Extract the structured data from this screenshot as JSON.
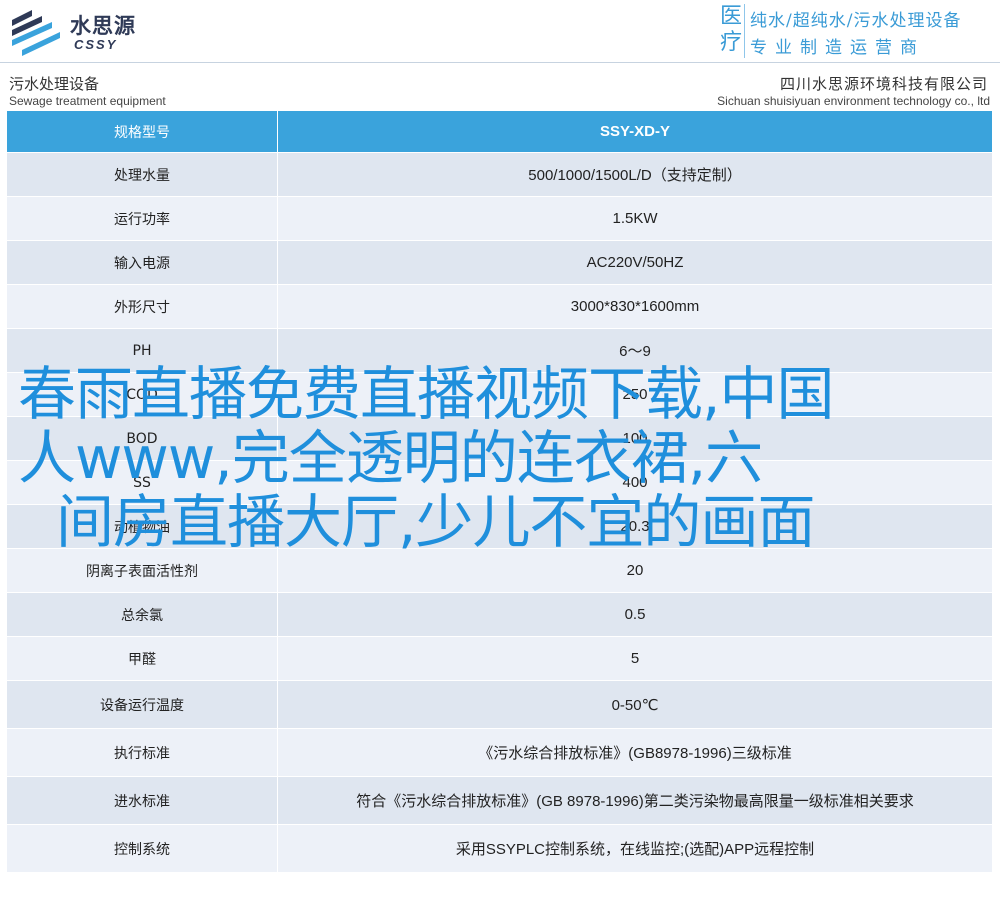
{
  "header": {
    "logo_cn": "水思源",
    "logo_en": "CSSY",
    "slogan_side": "医疗",
    "slogan_line1": "纯水/超纯水/污水处理设备",
    "slogan_line2": "专业制造运营商"
  },
  "subheader": {
    "left_cn": "污水处理设备",
    "left_en": "Sewage treatment equipment",
    "right_cn": "四川水思源环境科技有限公司",
    "right_en": "Sichuan shuisiyuan environment technology co., ltd"
  },
  "table": {
    "header": {
      "label": "规格型号",
      "value": "SSY-XD-Y"
    },
    "rows": [
      {
        "label": "处理水量",
        "value": "500/1000/1500L/D（支持定制）"
      },
      {
        "label": "运行功率",
        "value": "1.5KW"
      },
      {
        "label": "输入电源",
        "value": "AC220V/50HZ"
      },
      {
        "label": "外形尺寸",
        "value": "3000*830*1600mm"
      },
      {
        "label": "PH",
        "value": "6～9"
      },
      {
        "label": "COD",
        "value": "250"
      },
      {
        "label": "BOD",
        "value": "100"
      },
      {
        "label": "SS",
        "value": "400"
      },
      {
        "label": "动植物油",
        "value": "20.3"
      },
      {
        "label": "阴离子表面活性剂",
        "value": "20"
      },
      {
        "label": "总余氯",
        "value": "0.5"
      },
      {
        "label": "甲醛",
        "value": "5"
      },
      {
        "label": "设备运行温度",
        "value": "0-50℃"
      },
      {
        "label": "执行标准",
        "value": "《污水综合排放标准》(GB8978-1996)三级标准"
      },
      {
        "label": "进水标准",
        "value": "符合《污水综合排放标准》(GB 8978-1996)第二类污染物最高限量一级标准相关要求"
      },
      {
        "label": "控制系统",
        "value": "采用SSYPLC控制系统，在线监控;(选配)APP远程控制"
      }
    ]
  },
  "overlay": {
    "line1": "春雨直播免费直播视频下载,中国",
    "line2": "人www,完全透明的连衣裙,六",
    "line3": "间房直播大厅,少儿不宜的画面"
  },
  "colors": {
    "accent": "#3aa3dc",
    "overlay_text": "#1f8fdc",
    "row_light": "#edf1f8",
    "row_dark": "#dfe6f0",
    "logo_dark": "#2f3a57"
  }
}
